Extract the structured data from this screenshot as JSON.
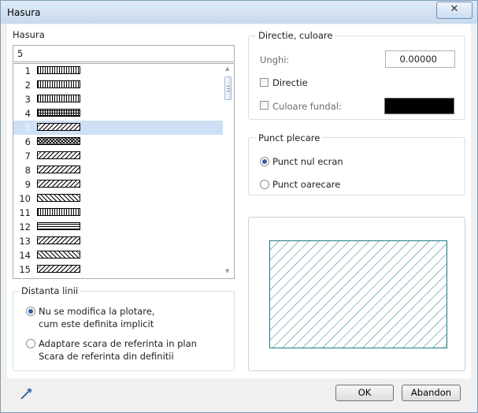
{
  "window": {
    "title": "Hasura",
    "close_glyph": "✕"
  },
  "hatch": {
    "label": "Hasura",
    "value": "5",
    "selected": "5",
    "items": [
      {
        "num": "1",
        "pattern": "vertical-lines"
      },
      {
        "num": "2",
        "pattern": "vertical-lines"
      },
      {
        "num": "3",
        "pattern": "vertical-lines"
      },
      {
        "num": "4",
        "pattern": "grid"
      },
      {
        "num": "5",
        "pattern": "diagonal"
      },
      {
        "num": "6",
        "pattern": "cross-hatch"
      },
      {
        "num": "7",
        "pattern": "diagonal"
      },
      {
        "num": "8",
        "pattern": "diagonal"
      },
      {
        "num": "9",
        "pattern": "diagonal"
      },
      {
        "num": "10",
        "pattern": "diagonal-reverse"
      },
      {
        "num": "11",
        "pattern": "vertical-lines"
      },
      {
        "num": "12",
        "pattern": "dashed-horizontal"
      },
      {
        "num": "13",
        "pattern": "diagonal"
      },
      {
        "num": "14",
        "pattern": "diagonal-reverse"
      },
      {
        "num": "15",
        "pattern": "diagonal"
      }
    ]
  },
  "direction": {
    "group_label": "Directie, culoare",
    "angle_label": "Unghi:",
    "angle_value": "0.00000",
    "direction_label": "Directie",
    "direction_checked": false,
    "bg_label": "Culoare fundal:",
    "bg_checked": false,
    "bg_color": "#000000"
  },
  "origin": {
    "group_label": "Punct plecare",
    "opt1": "Punct nul ecran",
    "opt2": "Punct oarecare",
    "selected": "opt1"
  },
  "preview": {
    "hatch_color": "#1e7b86",
    "pattern": "diagonal"
  },
  "spacing": {
    "group_label": "Distanta linii",
    "opt1_line1": "Nu se modifica la plotare,",
    "opt1_line2": "cum este definita implicit",
    "opt2_line1": "Adaptare scara de referinta in plan",
    "opt2_line2": "Scara de referinta din definitii",
    "selected": "opt1"
  },
  "footer": {
    "ok_label": "OK",
    "cancel_label": "Abandon",
    "tool_icon": "eyedropper-icon"
  }
}
